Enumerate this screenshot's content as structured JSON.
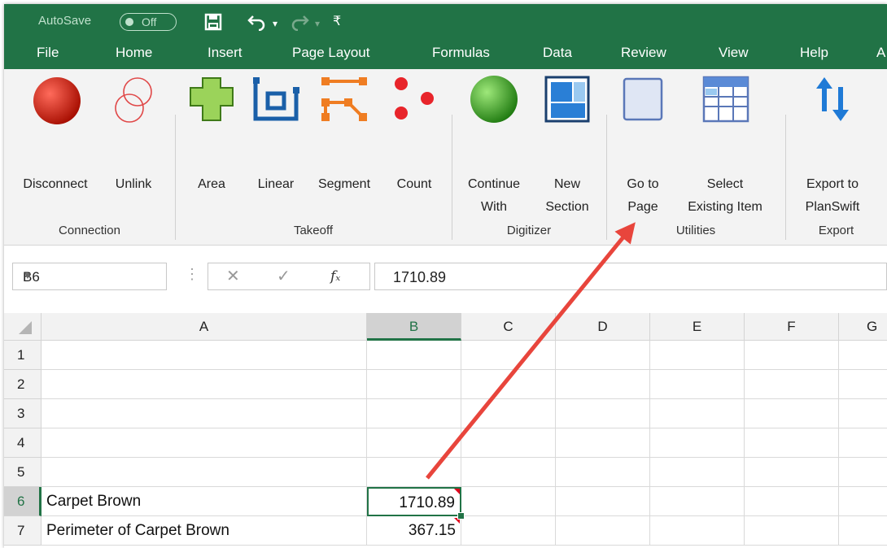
{
  "window": {
    "autosave_label": "AutoSave",
    "autosave_state": "Off",
    "accent": "#217346"
  },
  "menu": {
    "items": [
      "File",
      "Home",
      "Insert",
      "Page Layout",
      "Formulas",
      "Data",
      "Review",
      "View",
      "Help",
      "A"
    ]
  },
  "ribbon": {
    "groups": [
      {
        "name": "Connection",
        "buttons": [
          "Disconnect",
          "Unlink"
        ]
      },
      {
        "name": "Takeoff",
        "buttons": [
          "Area",
          "Linear",
          "Segment",
          "Count"
        ]
      },
      {
        "name": "Digitizer",
        "buttons": [
          {
            "l1": "Continue",
            "l2": "With"
          },
          {
            "l1": "New",
            "l2": "Section"
          }
        ]
      },
      {
        "name": "Utilities",
        "buttons": [
          {
            "l1": "Go to",
            "l2": "Page"
          },
          {
            "l1": "Select",
            "l2": "Existing Item"
          }
        ]
      },
      {
        "name": "Export",
        "buttons": [
          {
            "l1": "Export to",
            "l2": "PlanSwift"
          }
        ]
      }
    ]
  },
  "formula_bar": {
    "name_box": "B6",
    "fx": "fx",
    "value": "1710.89"
  },
  "sheet": {
    "columns": [
      "A",
      "B",
      "C",
      "D",
      "E",
      "F",
      "G"
    ],
    "rows": [
      "1",
      "2",
      "3",
      "4",
      "5",
      "6",
      "7"
    ],
    "cells": {
      "A6": "Carpet Brown",
      "B6": "1710.89",
      "A7": "Perimeter of Carpet Brown",
      "B7": "367.15"
    }
  },
  "annotation": {
    "arrow_color": "#e8453c"
  }
}
